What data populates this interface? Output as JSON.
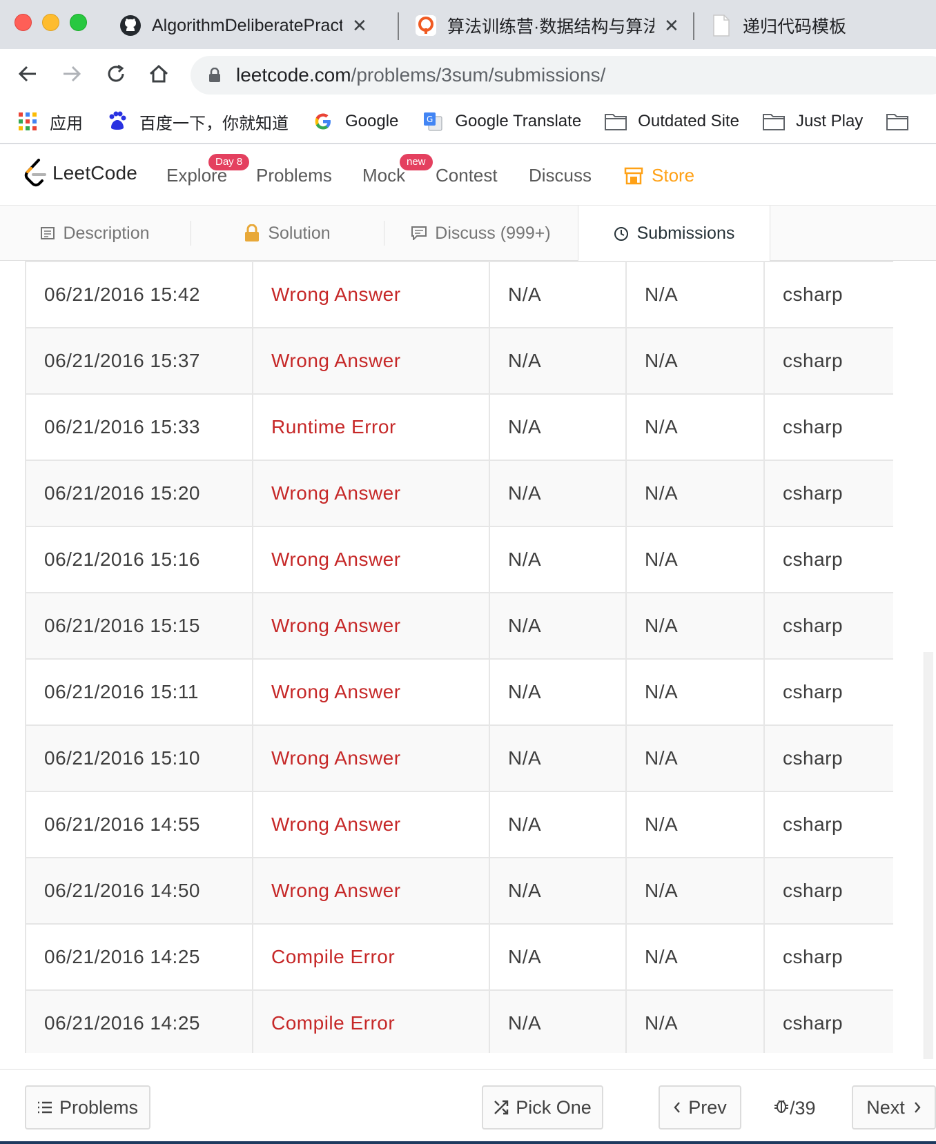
{
  "browser": {
    "tabs": [
      {
        "title": "AlgorithmDeliberatePractic",
        "icon": "github-icon"
      },
      {
        "title": "算法训练营·数据结构与算法",
        "icon": "geekbang-icon"
      },
      {
        "title": "递归代码模板",
        "icon": "document-icon"
      }
    ],
    "url_host": "leetcode.com",
    "url_path": "/problems/3sum/submissions/",
    "bookmarks": [
      {
        "label": "应用",
        "icon": "apps-grid-icon"
      },
      {
        "label": "百度一下，你就知道",
        "icon": "baidu-icon"
      },
      {
        "label": "Google",
        "icon": "google-icon"
      },
      {
        "label": "Google Translate",
        "icon": "google-translate-icon"
      },
      {
        "label": "Outdated Site",
        "icon": "folder-icon"
      },
      {
        "label": "Just Play",
        "icon": "folder-icon"
      }
    ]
  },
  "leetcode_nav": {
    "logo_text": "LeetCode",
    "links": {
      "explore": "Explore",
      "explore_badge": "Day 8",
      "problems": "Problems",
      "mock": "Mock",
      "mock_badge": "new",
      "contest": "Contest",
      "discuss": "Discuss",
      "store": "Store"
    },
    "colors": {
      "store": "#ffa116",
      "badge": "#e4405f"
    }
  },
  "problem_tabs": {
    "description": "Description",
    "solution": "Solution",
    "discuss": "Discuss (999+)",
    "submissions": "Submissions",
    "active": "Submissions"
  },
  "submissions": [
    {
      "time": "06/21/2016 15:42",
      "status": "Wrong Answer",
      "runtime": "N/A",
      "memory": "N/A",
      "language": "csharp"
    },
    {
      "time": "06/21/2016 15:37",
      "status": "Wrong Answer",
      "runtime": "N/A",
      "memory": "N/A",
      "language": "csharp"
    },
    {
      "time": "06/21/2016 15:33",
      "status": "Runtime Error",
      "runtime": "N/A",
      "memory": "N/A",
      "language": "csharp"
    },
    {
      "time": "06/21/2016 15:20",
      "status": "Wrong Answer",
      "runtime": "N/A",
      "memory": "N/A",
      "language": "csharp"
    },
    {
      "time": "06/21/2016 15:16",
      "status": "Wrong Answer",
      "runtime": "N/A",
      "memory": "N/A",
      "language": "csharp"
    },
    {
      "time": "06/21/2016 15:15",
      "status": "Wrong Answer",
      "runtime": "N/A",
      "memory": "N/A",
      "language": "csharp"
    },
    {
      "time": "06/21/2016 15:11",
      "status": "Wrong Answer",
      "runtime": "N/A",
      "memory": "N/A",
      "language": "csharp"
    },
    {
      "time": "06/21/2016 15:10",
      "status": "Wrong Answer",
      "runtime": "N/A",
      "memory": "N/A",
      "language": "csharp"
    },
    {
      "time": "06/21/2016 14:55",
      "status": "Wrong Answer",
      "runtime": "N/A",
      "memory": "N/A",
      "language": "csharp"
    },
    {
      "time": "06/21/2016 14:50",
      "status": "Wrong Answer",
      "runtime": "N/A",
      "memory": "N/A",
      "language": "csharp"
    },
    {
      "time": "06/21/2016 14:25",
      "status": "Compile Error",
      "runtime": "N/A",
      "memory": "N/A",
      "language": "csharp"
    },
    {
      "time": "06/21/2016 14:25",
      "status": "Compile Error",
      "runtime": "N/A",
      "memory": "N/A",
      "language": "csharp"
    }
  ],
  "footer": {
    "problems": "Problems",
    "pick_one": "Pick One",
    "prev": "Prev",
    "page_total": "/39",
    "next": "Next"
  },
  "colors": {
    "error_status": "#c62828"
  }
}
